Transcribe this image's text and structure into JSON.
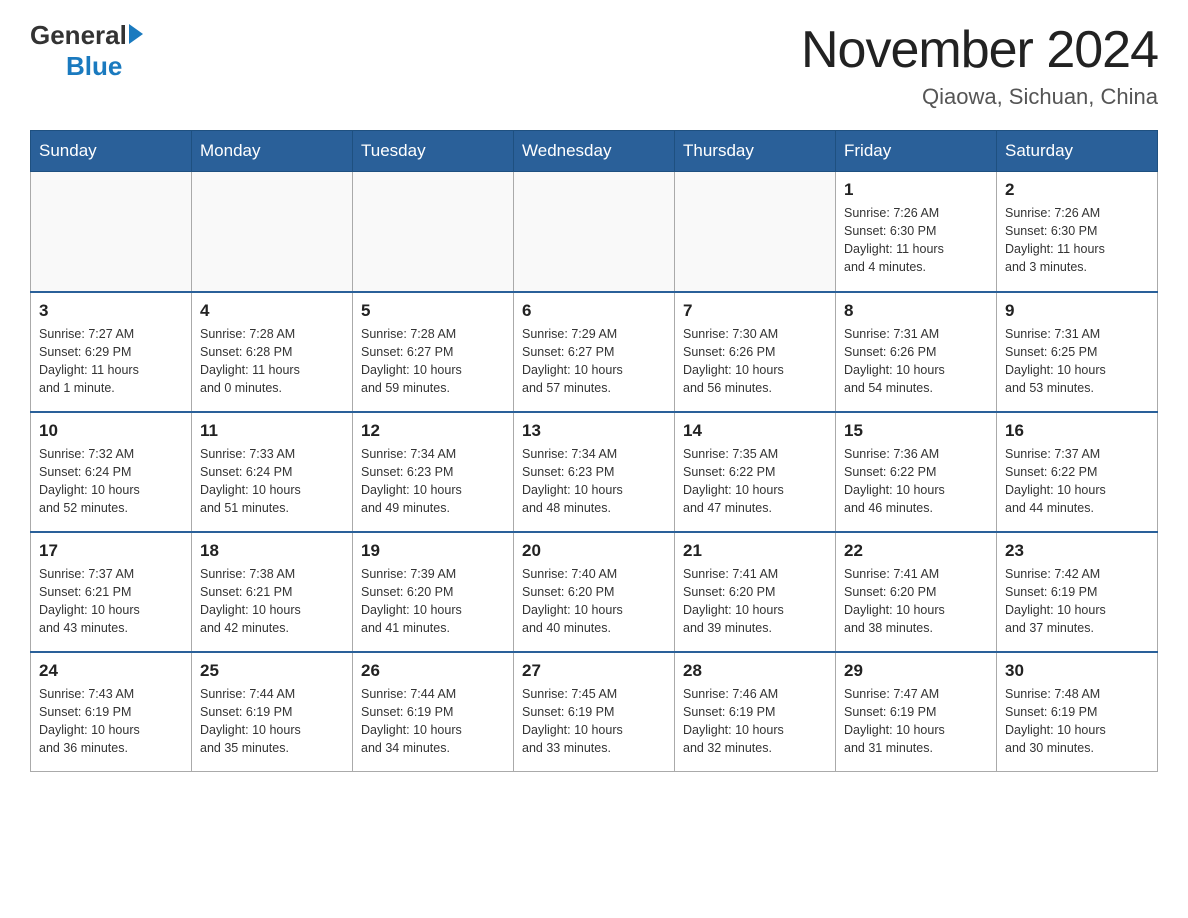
{
  "header": {
    "title": "November 2024",
    "location": "Qiaowa, Sichuan, China",
    "logo_general": "General",
    "logo_blue": "Blue"
  },
  "days_of_week": [
    "Sunday",
    "Monday",
    "Tuesday",
    "Wednesday",
    "Thursday",
    "Friday",
    "Saturday"
  ],
  "weeks": [
    [
      {
        "day": "",
        "info": ""
      },
      {
        "day": "",
        "info": ""
      },
      {
        "day": "",
        "info": ""
      },
      {
        "day": "",
        "info": ""
      },
      {
        "day": "",
        "info": ""
      },
      {
        "day": "1",
        "info": "Sunrise: 7:26 AM\nSunset: 6:30 PM\nDaylight: 11 hours\nand 4 minutes."
      },
      {
        "day": "2",
        "info": "Sunrise: 7:26 AM\nSunset: 6:30 PM\nDaylight: 11 hours\nand 3 minutes."
      }
    ],
    [
      {
        "day": "3",
        "info": "Sunrise: 7:27 AM\nSunset: 6:29 PM\nDaylight: 11 hours\nand 1 minute."
      },
      {
        "day": "4",
        "info": "Sunrise: 7:28 AM\nSunset: 6:28 PM\nDaylight: 11 hours\nand 0 minutes."
      },
      {
        "day": "5",
        "info": "Sunrise: 7:28 AM\nSunset: 6:27 PM\nDaylight: 10 hours\nand 59 minutes."
      },
      {
        "day": "6",
        "info": "Sunrise: 7:29 AM\nSunset: 6:27 PM\nDaylight: 10 hours\nand 57 minutes."
      },
      {
        "day": "7",
        "info": "Sunrise: 7:30 AM\nSunset: 6:26 PM\nDaylight: 10 hours\nand 56 minutes."
      },
      {
        "day": "8",
        "info": "Sunrise: 7:31 AM\nSunset: 6:26 PM\nDaylight: 10 hours\nand 54 minutes."
      },
      {
        "day": "9",
        "info": "Sunrise: 7:31 AM\nSunset: 6:25 PM\nDaylight: 10 hours\nand 53 minutes."
      }
    ],
    [
      {
        "day": "10",
        "info": "Sunrise: 7:32 AM\nSunset: 6:24 PM\nDaylight: 10 hours\nand 52 minutes."
      },
      {
        "day": "11",
        "info": "Sunrise: 7:33 AM\nSunset: 6:24 PM\nDaylight: 10 hours\nand 51 minutes."
      },
      {
        "day": "12",
        "info": "Sunrise: 7:34 AM\nSunset: 6:23 PM\nDaylight: 10 hours\nand 49 minutes."
      },
      {
        "day": "13",
        "info": "Sunrise: 7:34 AM\nSunset: 6:23 PM\nDaylight: 10 hours\nand 48 minutes."
      },
      {
        "day": "14",
        "info": "Sunrise: 7:35 AM\nSunset: 6:22 PM\nDaylight: 10 hours\nand 47 minutes."
      },
      {
        "day": "15",
        "info": "Sunrise: 7:36 AM\nSunset: 6:22 PM\nDaylight: 10 hours\nand 46 minutes."
      },
      {
        "day": "16",
        "info": "Sunrise: 7:37 AM\nSunset: 6:22 PM\nDaylight: 10 hours\nand 44 minutes."
      }
    ],
    [
      {
        "day": "17",
        "info": "Sunrise: 7:37 AM\nSunset: 6:21 PM\nDaylight: 10 hours\nand 43 minutes."
      },
      {
        "day": "18",
        "info": "Sunrise: 7:38 AM\nSunset: 6:21 PM\nDaylight: 10 hours\nand 42 minutes."
      },
      {
        "day": "19",
        "info": "Sunrise: 7:39 AM\nSunset: 6:20 PM\nDaylight: 10 hours\nand 41 minutes."
      },
      {
        "day": "20",
        "info": "Sunrise: 7:40 AM\nSunset: 6:20 PM\nDaylight: 10 hours\nand 40 minutes."
      },
      {
        "day": "21",
        "info": "Sunrise: 7:41 AM\nSunset: 6:20 PM\nDaylight: 10 hours\nand 39 minutes."
      },
      {
        "day": "22",
        "info": "Sunrise: 7:41 AM\nSunset: 6:20 PM\nDaylight: 10 hours\nand 38 minutes."
      },
      {
        "day": "23",
        "info": "Sunrise: 7:42 AM\nSunset: 6:19 PM\nDaylight: 10 hours\nand 37 minutes."
      }
    ],
    [
      {
        "day": "24",
        "info": "Sunrise: 7:43 AM\nSunset: 6:19 PM\nDaylight: 10 hours\nand 36 minutes."
      },
      {
        "day": "25",
        "info": "Sunrise: 7:44 AM\nSunset: 6:19 PM\nDaylight: 10 hours\nand 35 minutes."
      },
      {
        "day": "26",
        "info": "Sunrise: 7:44 AM\nSunset: 6:19 PM\nDaylight: 10 hours\nand 34 minutes."
      },
      {
        "day": "27",
        "info": "Sunrise: 7:45 AM\nSunset: 6:19 PM\nDaylight: 10 hours\nand 33 minutes."
      },
      {
        "day": "28",
        "info": "Sunrise: 7:46 AM\nSunset: 6:19 PM\nDaylight: 10 hours\nand 32 minutes."
      },
      {
        "day": "29",
        "info": "Sunrise: 7:47 AM\nSunset: 6:19 PM\nDaylight: 10 hours\nand 31 minutes."
      },
      {
        "day": "30",
        "info": "Sunrise: 7:48 AM\nSunset: 6:19 PM\nDaylight: 10 hours\nand 30 minutes."
      }
    ]
  ]
}
